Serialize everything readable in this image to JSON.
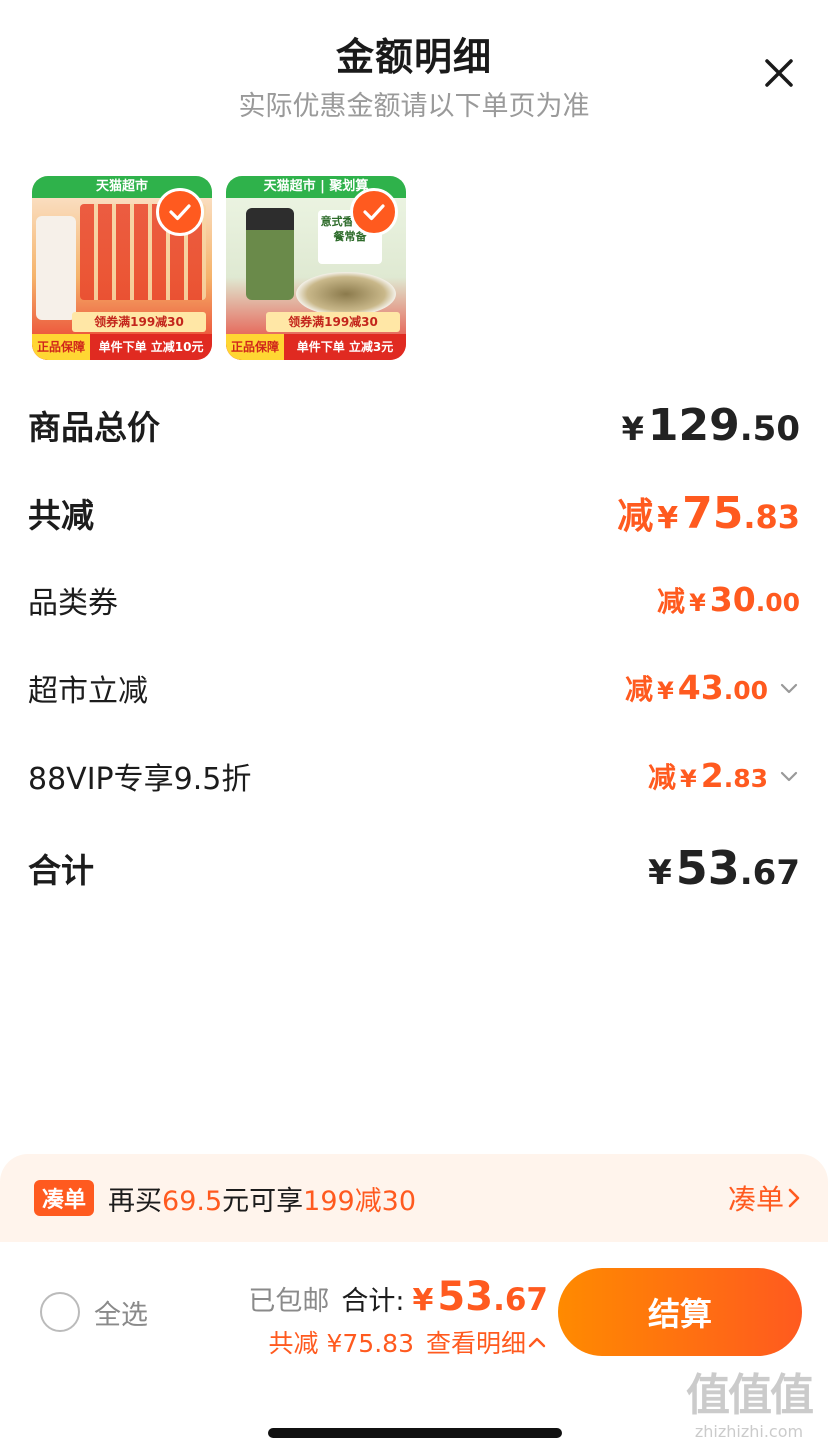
{
  "header": {
    "title": "金额明细",
    "subtitle": "实际优惠金额请以下单页为准"
  },
  "products": [
    {
      "banner": "天猫超市",
      "coupon": "领券满199减30",
      "tag": "正品保障",
      "promo": "单件下单 立减10元",
      "selected": true
    },
    {
      "banner": "天猫超市 | 聚划算",
      "label": "意式香草 西餐常备",
      "coupon": "领券满199减30",
      "tag": "正品保障",
      "promo": "单件下单 立减3元",
      "selected": true
    }
  ],
  "breakdown": {
    "total_price": {
      "label": "商品总价",
      "yen": "¥",
      "int": "129",
      "dec": ".50"
    },
    "total_reduce": {
      "label": "共减",
      "prefix": "减",
      "yen": "¥",
      "int": "75",
      "dec": ".83"
    },
    "coupon": {
      "label": "品类券",
      "prefix": "减",
      "yen": "¥",
      "int": "30",
      "dec": ".00"
    },
    "market": {
      "label": "超市立减",
      "prefix": "减",
      "yen": "¥",
      "int": "43",
      "dec": ".00"
    },
    "vip": {
      "label": "88VIP专享9.5折",
      "prefix": "减",
      "yen": "¥",
      "int": "2",
      "dec": ".83"
    },
    "sum": {
      "label": "合计",
      "yen": "¥",
      "int": "53",
      "dec": ".67"
    }
  },
  "bundle": {
    "tag": "凑单",
    "text_pre": "再买",
    "amount": "69.5",
    "text_mid": "元可享",
    "offer": "199减30",
    "link": "凑单"
  },
  "bottom": {
    "select_all": "全选",
    "shipped": "已包邮",
    "total_label": "合计:",
    "total_yen": "¥",
    "total_int": "53",
    "total_dec": ".67",
    "reduce_note": "共减 ¥75.83",
    "detail_link": "查看明细",
    "checkout": "结算"
  },
  "watermark": {
    "logo": "值值值",
    "url": "zhizhizhi.com"
  },
  "colors": {
    "accent": "#ff5a1f",
    "accent_gradient_start": "#ff8a00",
    "subtle_text": "#9a9a9a",
    "bundle_bg": "#fff4ec"
  },
  "icons": [
    "close-icon",
    "checkmark-icon",
    "chevron-down-icon",
    "chevron-right-icon",
    "chevron-up-icon"
  ]
}
